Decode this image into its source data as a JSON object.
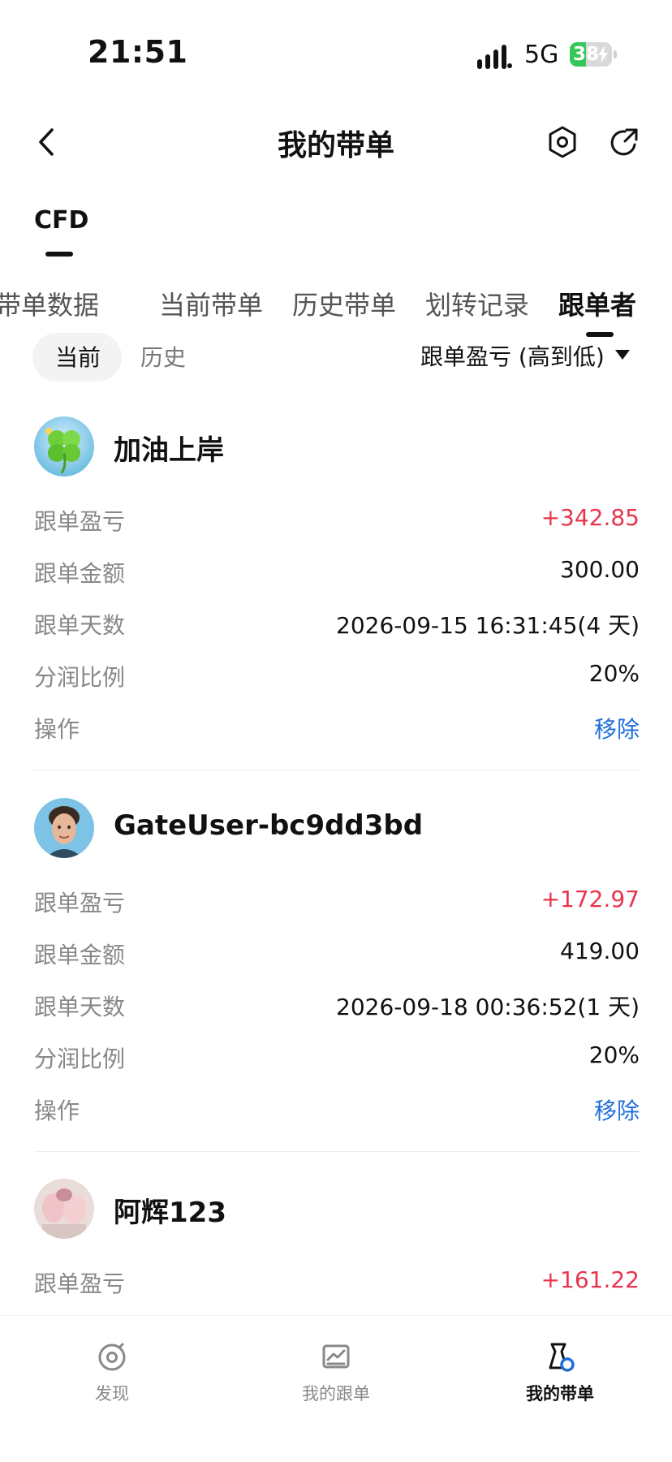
{
  "status_bar": {
    "time": "21:51",
    "network": "5G",
    "battery": "38",
    "battery_level": 0.38
  },
  "header": {
    "title": "我的带单"
  },
  "category": "CFD",
  "tabs": [
    "带单数据",
    "当前带单",
    "历史带单",
    "划转记录",
    "跟单者"
  ],
  "active_tab": "跟单者",
  "subtabs": {
    "current": "当前",
    "history": "历史"
  },
  "sort_label": "跟单盈亏 (高到低)",
  "row_labels": {
    "pnl": "跟单盈亏",
    "amount": "跟单金额",
    "days": "跟单天数",
    "share": "分润比例",
    "action": "操作"
  },
  "followers": [
    {
      "name": "加油上岸",
      "pnl": "+342.85",
      "amount": "300.00",
      "days": "2026-09-15 16:31:45(4 天)",
      "share": "20%",
      "action": "移除"
    },
    {
      "name": "GateUser-bc9dd3bd",
      "pnl": "+172.97",
      "amount": "419.00",
      "days": "2026-09-18 00:36:52(1 天)",
      "share": "20%",
      "action": "移除"
    },
    {
      "name": "阿辉123",
      "pnl": "+161.22"
    }
  ],
  "bottom_nav": [
    {
      "label": "发现",
      "icon": "discover-icon"
    },
    {
      "label": "我的跟单",
      "icon": "chart-icon"
    },
    {
      "label": "我的带单",
      "icon": "lead-trade-icon"
    }
  ],
  "colors": {
    "positive": "#e8344c",
    "link": "#1f6fdb",
    "battery": "#34c759"
  }
}
